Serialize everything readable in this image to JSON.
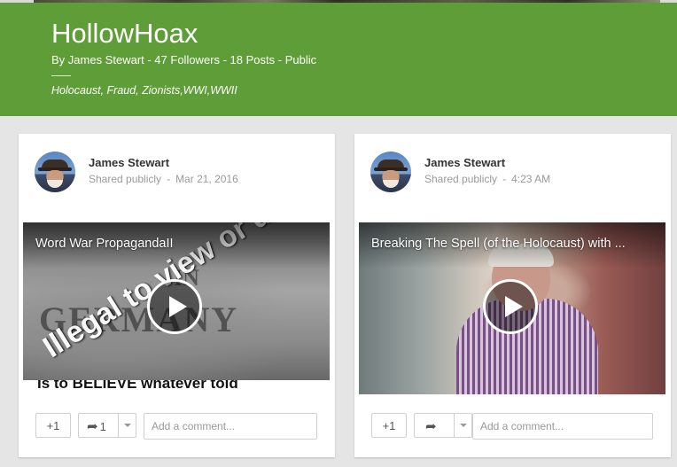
{
  "collection": {
    "title": "HollowHoax",
    "meta": "By James Stewart - 47 Followers - 18 Posts - Public",
    "tags": "Holocaust, Fraud, Zionists,WWI,WWII",
    "banner_color": "#5f9d38"
  },
  "posts": [
    {
      "author": "James Stewart",
      "visibility": "Shared publicly",
      "separator": "-",
      "time": "Mar 21, 2016",
      "video_title": "Word War PropagandaII",
      "video_overlay_germany": "GERMANY",
      "video_overlay_in": "IN",
      "video_overlay_diagonal": "Illegal to view or doubt",
      "video_bottom_text": "Is to BELIEVE whatever told",
      "plus_label": "+1",
      "share_count": "1",
      "comment_placeholder": "Add a comment...",
      "icons": {
        "play": "play-icon",
        "share": "share-arrow-icon",
        "dropdown": "caret-down-icon"
      }
    },
    {
      "author": "James Stewart",
      "visibility": "Shared publicly",
      "separator": "-",
      "time": "4:23 AM",
      "video_title": "Breaking The Spell (of the Holocaust) with ...",
      "plus_label": "+1",
      "share_count": "",
      "comment_placeholder": "Add a comment...",
      "icons": {
        "play": "play-icon",
        "share": "share-arrow-icon",
        "dropdown": "caret-down-icon"
      }
    }
  ]
}
